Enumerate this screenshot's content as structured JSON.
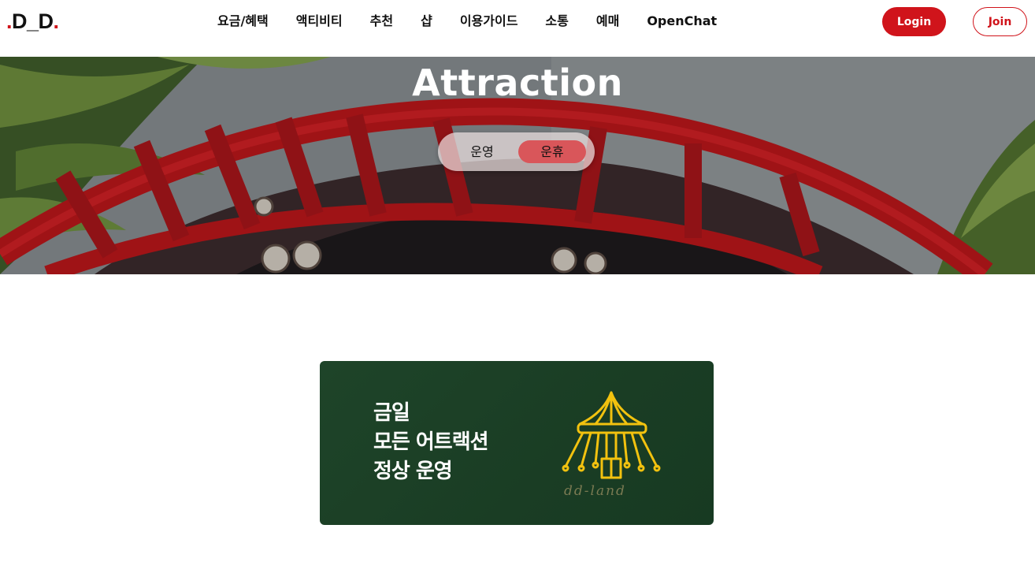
{
  "header": {
    "logo": {
      "dot_left": ".",
      "text": "D_D",
      "dot_right": "."
    },
    "nav": [
      "요금/혜택",
      "액티비티",
      "추천",
      "샵",
      "이용가이드",
      "소통",
      "예매",
      "OpenChat"
    ],
    "login_label": "Login",
    "join_label": "Join"
  },
  "hero": {
    "title": "Attraction",
    "toggle": {
      "option_1": "운영",
      "option_2": "운휴",
      "selected": "운휴"
    }
  },
  "banner": {
    "lines": [
      "금일",
      "모든 어트랙션",
      "정상 운영"
    ],
    "logo_icon": "carousel-icon",
    "logo_text": "dd-land"
  },
  "colors": {
    "accent": "#d0141b",
    "toggle_selected": "#d9565a",
    "banner_bg": "#1e4429",
    "banner_icon": "#f2c20f"
  }
}
